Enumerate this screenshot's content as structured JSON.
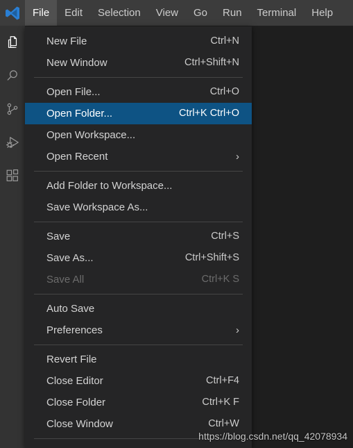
{
  "window": {
    "app": "Visual Studio Code",
    "logo_icon": "vscode-logo-icon",
    "background_color": "#1e1e1e",
    "titlebar_color": "#3c3c3c",
    "menu_background_color": "#252526",
    "selection_color": "#0e5384"
  },
  "menubar": {
    "items": [
      {
        "label": "File",
        "active": true
      },
      {
        "label": "Edit",
        "active": false
      },
      {
        "label": "Selection",
        "active": false
      },
      {
        "label": "View",
        "active": false
      },
      {
        "label": "Go",
        "active": false
      },
      {
        "label": "Run",
        "active": false
      },
      {
        "label": "Terminal",
        "active": false
      },
      {
        "label": "Help",
        "active": false
      }
    ]
  },
  "activitybar": {
    "items": [
      {
        "name": "explorer-icon",
        "title": "Explorer",
        "active": true
      },
      {
        "name": "search-icon",
        "title": "Search",
        "active": false
      },
      {
        "name": "source-control-icon",
        "title": "Source Control",
        "active": false
      },
      {
        "name": "run-and-debug-icon",
        "title": "Run and Debug",
        "active": false
      },
      {
        "name": "extensions-icon",
        "title": "Extensions",
        "active": false
      }
    ]
  },
  "file_menu": {
    "open": true,
    "entries": [
      {
        "type": "item",
        "label": "New File",
        "shortcut": "Ctrl+N",
        "selected": false,
        "disabled": false,
        "submenu": false
      },
      {
        "type": "item",
        "label": "New Window",
        "shortcut": "Ctrl+Shift+N",
        "selected": false,
        "disabled": false,
        "submenu": false
      },
      {
        "type": "separator"
      },
      {
        "type": "item",
        "label": "Open File...",
        "shortcut": "Ctrl+O",
        "selected": false,
        "disabled": false,
        "submenu": false
      },
      {
        "type": "item",
        "label": "Open Folder...",
        "shortcut": "Ctrl+K Ctrl+O",
        "selected": true,
        "disabled": false,
        "submenu": false
      },
      {
        "type": "item",
        "label": "Open Workspace...",
        "shortcut": "",
        "selected": false,
        "disabled": false,
        "submenu": false
      },
      {
        "type": "item",
        "label": "Open Recent",
        "shortcut": "",
        "selected": false,
        "disabled": false,
        "submenu": true
      },
      {
        "type": "separator"
      },
      {
        "type": "item",
        "label": "Add Folder to Workspace...",
        "shortcut": "",
        "selected": false,
        "disabled": false,
        "submenu": false
      },
      {
        "type": "item",
        "label": "Save Workspace As...",
        "shortcut": "",
        "selected": false,
        "disabled": false,
        "submenu": false
      },
      {
        "type": "separator"
      },
      {
        "type": "item",
        "label": "Save",
        "shortcut": "Ctrl+S",
        "selected": false,
        "disabled": false,
        "submenu": false
      },
      {
        "type": "item",
        "label": "Save As...",
        "shortcut": "Ctrl+Shift+S",
        "selected": false,
        "disabled": false,
        "submenu": false
      },
      {
        "type": "item",
        "label": "Save All",
        "shortcut": "Ctrl+K S",
        "selected": false,
        "disabled": true,
        "submenu": false
      },
      {
        "type": "separator"
      },
      {
        "type": "item",
        "label": "Auto Save",
        "shortcut": "",
        "selected": false,
        "disabled": false,
        "submenu": false
      },
      {
        "type": "item",
        "label": "Preferences",
        "shortcut": "",
        "selected": false,
        "disabled": false,
        "submenu": true
      },
      {
        "type": "separator"
      },
      {
        "type": "item",
        "label": "Revert File",
        "shortcut": "",
        "selected": false,
        "disabled": false,
        "submenu": false
      },
      {
        "type": "item",
        "label": "Close Editor",
        "shortcut": "Ctrl+F4",
        "selected": false,
        "disabled": false,
        "submenu": false
      },
      {
        "type": "item",
        "label": "Close Folder",
        "shortcut": "Ctrl+K F",
        "selected": false,
        "disabled": false,
        "submenu": false
      },
      {
        "type": "item",
        "label": "Close Window",
        "shortcut": "Ctrl+W",
        "selected": false,
        "disabled": false,
        "submenu": false
      },
      {
        "type": "separator"
      }
    ],
    "submenu_arrow_glyph": "›"
  },
  "watermark": {
    "text": "https://blog.csdn.net/qq_42078934"
  }
}
